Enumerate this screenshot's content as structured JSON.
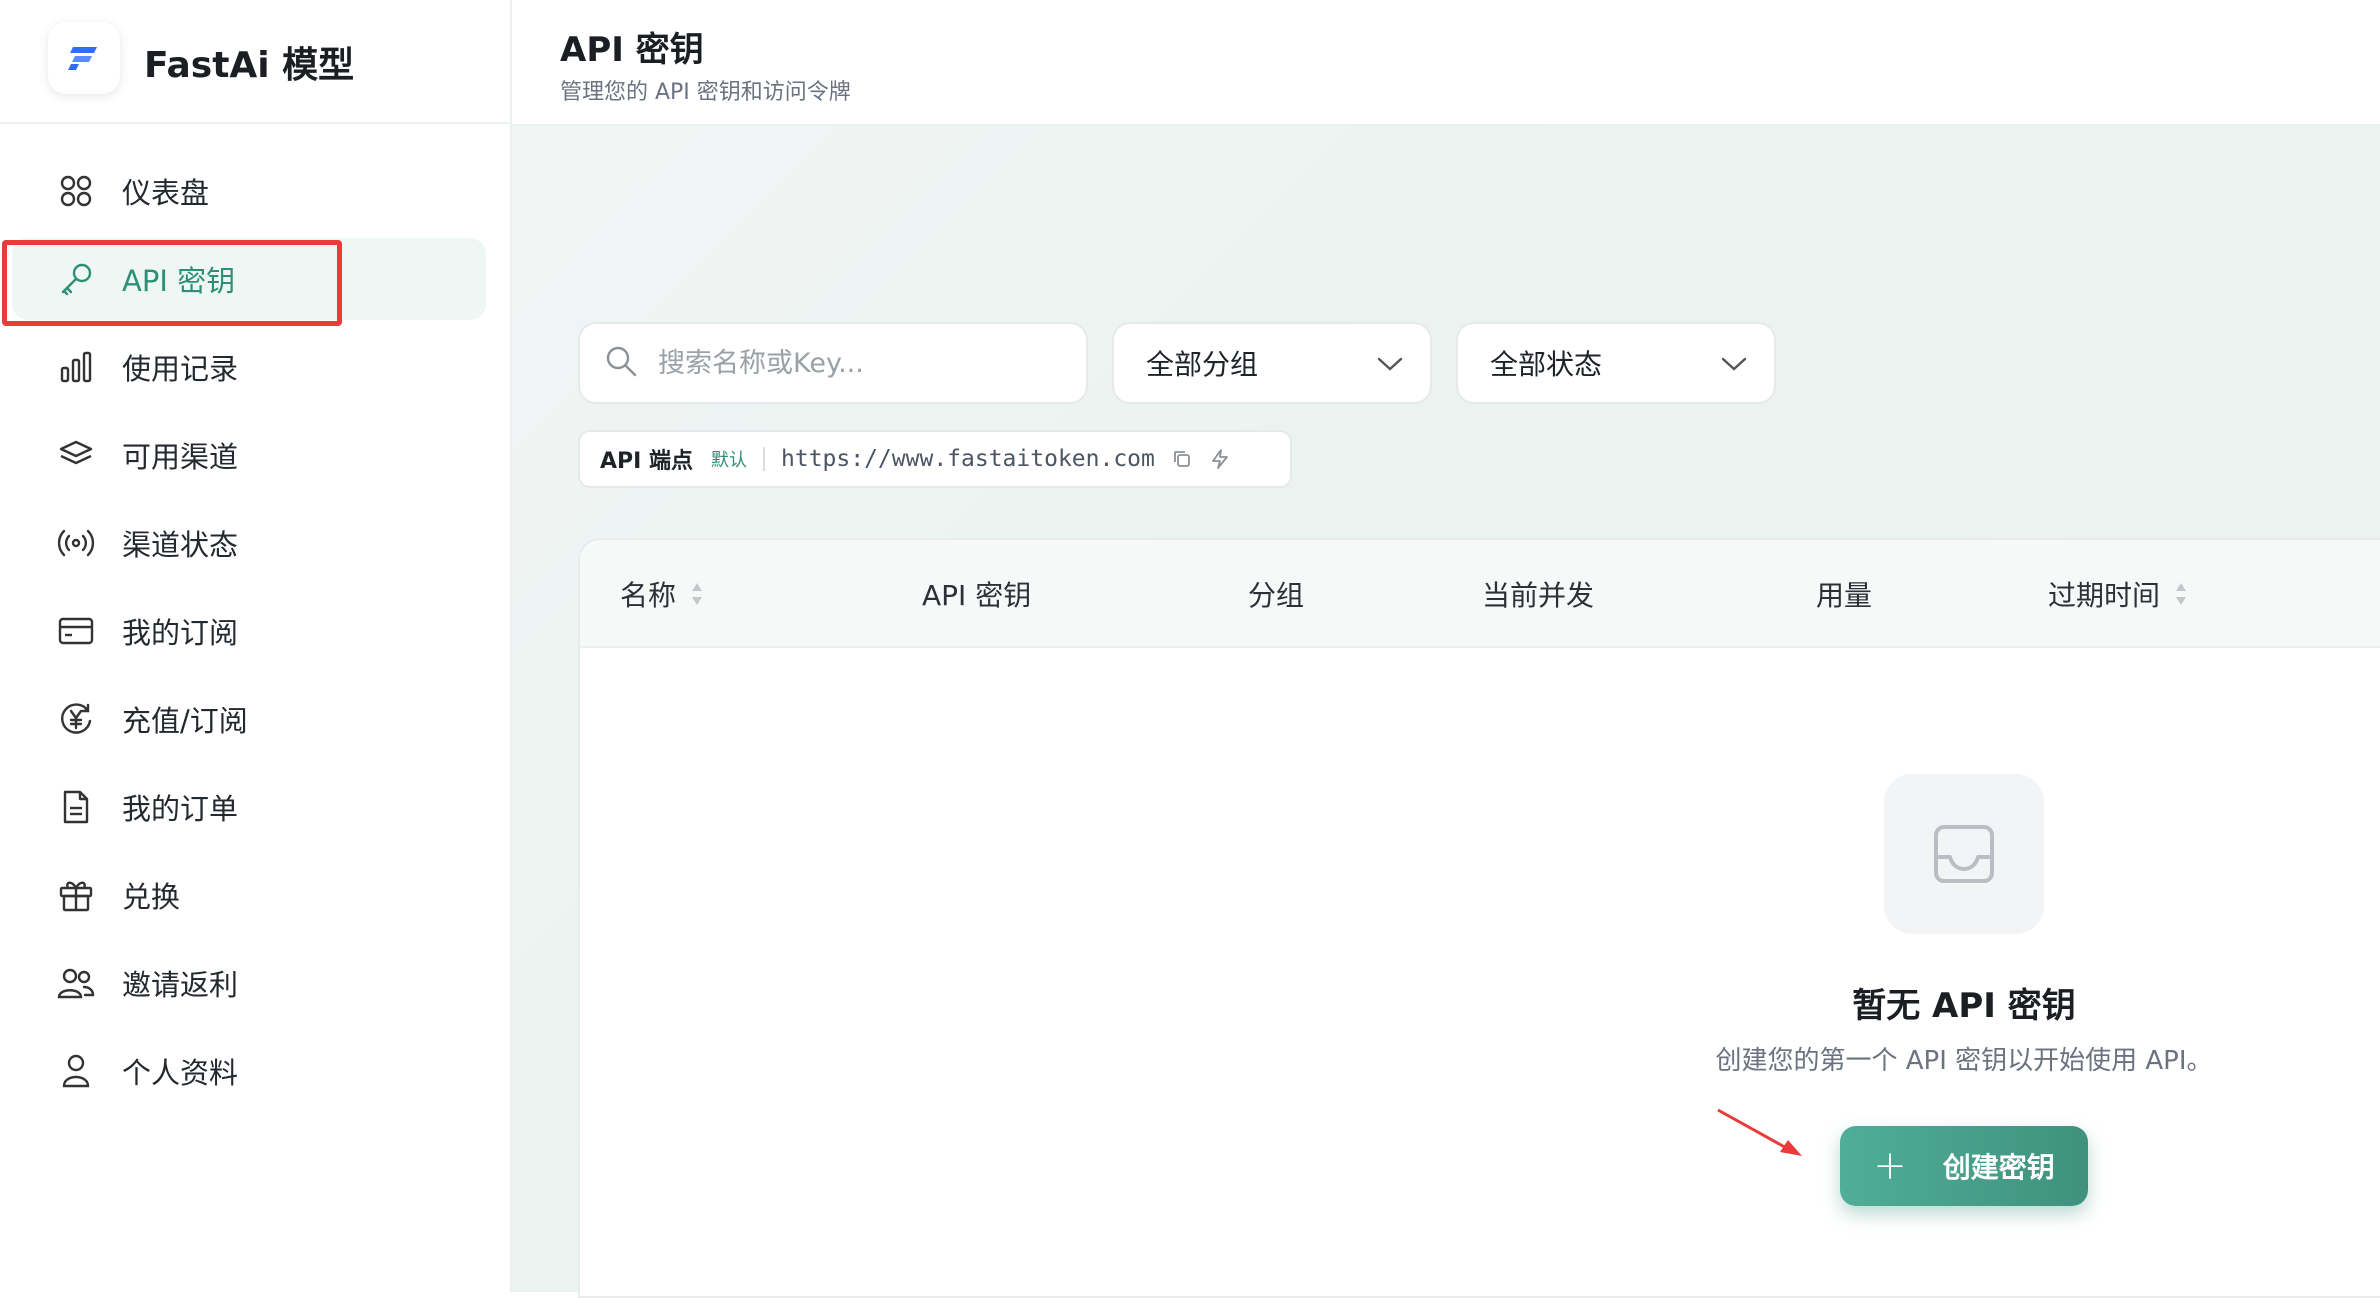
{
  "brand": {
    "name": "FastAi 模型"
  },
  "sidebar": {
    "items": [
      {
        "label": "仪表盘",
        "icon": "dashboard-icon"
      },
      {
        "label": "API 密钥",
        "icon": "key-icon",
        "active": true
      },
      {
        "label": "使用记录",
        "icon": "bar-chart-icon"
      },
      {
        "label": "可用渠道",
        "icon": "layers-icon"
      },
      {
        "label": "渠道状态",
        "icon": "broadcast-icon"
      },
      {
        "label": "我的订阅",
        "icon": "credit-card-icon"
      },
      {
        "label": "充值/订阅",
        "icon": "yen-circle-icon"
      },
      {
        "label": "我的订单",
        "icon": "document-icon"
      },
      {
        "label": "兑换",
        "icon": "gift-icon"
      },
      {
        "label": "邀请返利",
        "icon": "users-icon"
      },
      {
        "label": "个人资料",
        "icon": "user-icon"
      }
    ]
  },
  "header": {
    "title": "API 密钥",
    "subtitle": "管理您的 API 密钥和访问令牌"
  },
  "filters": {
    "search_placeholder": "搜索名称或Key...",
    "group_value": "全部分组",
    "status_value": "全部状态"
  },
  "endpoint": {
    "label": "API 端点",
    "badge": "默认",
    "url": "https://www.fastaitoken.com"
  },
  "table": {
    "columns": [
      "名称",
      "API 密钥",
      "分组",
      "当前并发",
      "用量",
      "过期时间"
    ]
  },
  "empty": {
    "title": "暂无 API 密钥",
    "description": "创建您的第一个 API 密钥以开始使用 API。",
    "button_label": "创建密钥"
  },
  "colors": {
    "accent": "#3f917d",
    "highlight": "#ea3b3b"
  }
}
